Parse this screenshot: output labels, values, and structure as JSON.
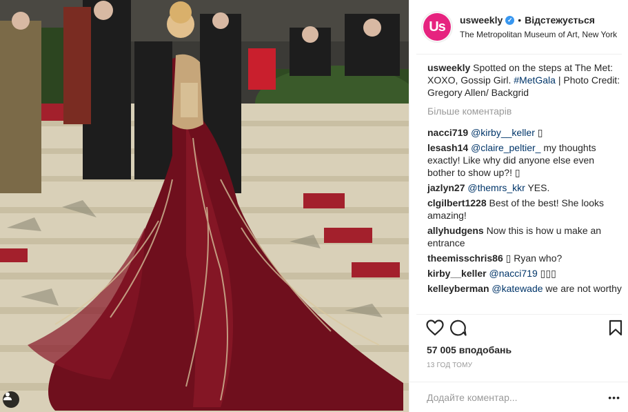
{
  "header": {
    "username": "usweekly",
    "avatar_text": "Us",
    "separator": "•",
    "follow_label": "Відстежується",
    "location": "The Metropolitan Museum of Art, New York"
  },
  "caption": {
    "user": "usweekly",
    "text_before": "Spotted on the steps at The Met: XOXO, Gossip Girl. ",
    "hashtag": "#MetGala",
    "text_after": " | Photo Credit: Gregory Allen/ Backgrid"
  },
  "more_comments": "Більше коментарів",
  "comments": [
    {
      "user": "nacci719",
      "mention": "@kirby__keller",
      "text": " ▯"
    },
    {
      "user": "lesash14",
      "mention": "@claire_peltier_",
      "text": " my thoughts exactly! Like why did anyone else even bother to show up?! ▯"
    },
    {
      "user": "jazlyn27",
      "mention": "@themrs_kkr",
      "text": " YES."
    },
    {
      "user": "clgilbert1228",
      "mention": "",
      "text": "Best of the best! She looks amazing!"
    },
    {
      "user": "allyhudgens",
      "mention": "",
      "text": "Now this is how u make an entrance"
    },
    {
      "user": "theemisschris86",
      "mention": "",
      "text": "▯ Ryan who?"
    },
    {
      "user": "kirby__keller",
      "mention": "@nacci719",
      "text": " ▯▯▯"
    },
    {
      "user": "kelleyberman",
      "mention": "@katewade",
      "text": " we are not worthy"
    }
  ],
  "likes": "57 005 вподобань",
  "time_ago": "13 ГОД ТОМУ",
  "add_comment_placeholder": "Додайте коментар...",
  "more_options": "•••",
  "icons": {
    "like": "heart-icon",
    "comment": "comment-bubble-icon",
    "save": "bookmark-icon",
    "verified": "verified-badge-icon",
    "tag": "user-tag-icon"
  },
  "colors": {
    "link": "#003569",
    "verified": "#3897f0",
    "brand": "#e6237f",
    "muted": "#999999"
  }
}
